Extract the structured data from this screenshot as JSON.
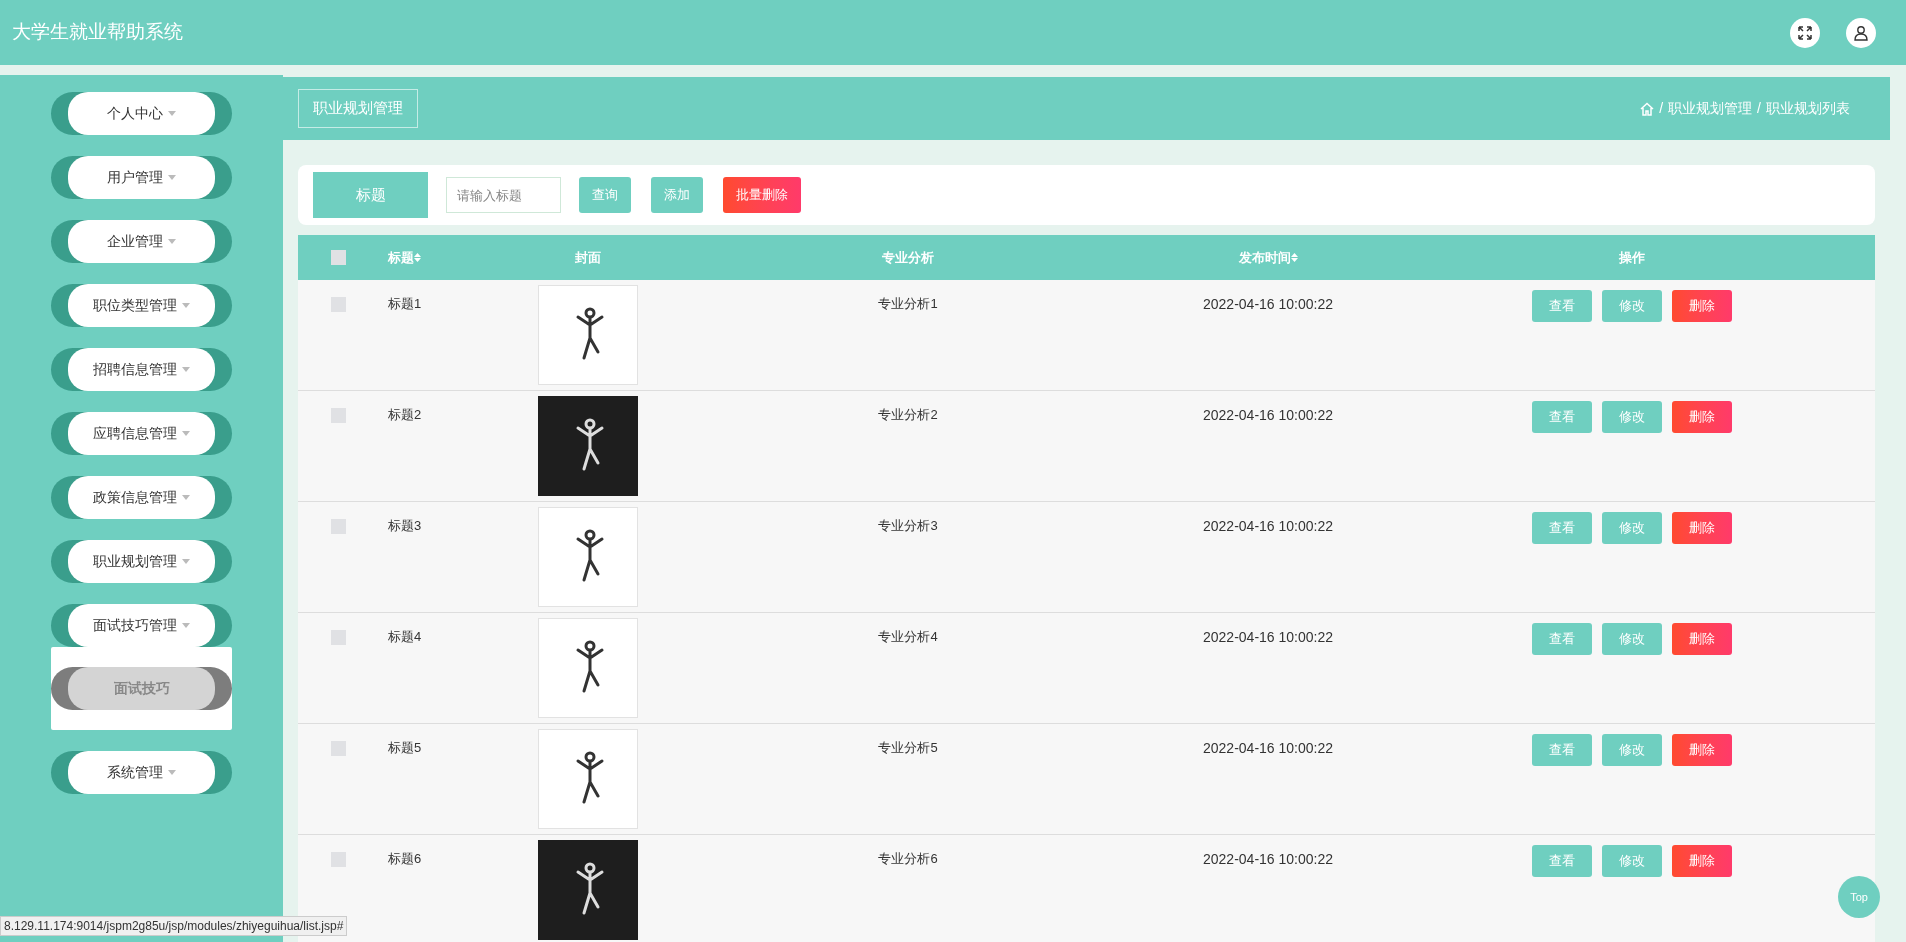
{
  "header": {
    "title": "大学生就业帮助系统"
  },
  "sidebar": {
    "items": [
      {
        "label": "个人中心"
      },
      {
        "label": "用户管理"
      },
      {
        "label": "企业管理"
      },
      {
        "label": "职位类型管理"
      },
      {
        "label": "招聘信息管理"
      },
      {
        "label": "应聘信息管理"
      },
      {
        "label": "政策信息管理"
      },
      {
        "label": "职业规划管理"
      },
      {
        "label": "面试技巧管理",
        "children": [
          {
            "label": "面试技巧"
          }
        ]
      },
      {
        "label": "系统管理"
      }
    ]
  },
  "page": {
    "title": "职业规划管理",
    "breadcrumb": [
      {
        "separator": "/",
        "label": "职业规划管理"
      },
      {
        "separator": "/",
        "label": "职业规划列表"
      }
    ]
  },
  "search": {
    "label": "标题",
    "placeholder": "请输入标题",
    "buttons": [
      {
        "label": "查询",
        "kind": "primary"
      },
      {
        "label": "添加",
        "kind": "primary"
      },
      {
        "label": "批量删除",
        "kind": "danger"
      }
    ]
  },
  "table": {
    "columns": [
      {
        "label": "标题",
        "sortable": true
      },
      {
        "label": "封面",
        "sortable": false
      },
      {
        "label": "专业分析",
        "sortable": false
      },
      {
        "label": "发布时间",
        "sortable": true
      },
      {
        "label": "操作",
        "sortable": false
      }
    ],
    "header_checked": false,
    "rows": [
      {
        "checked": false,
        "title": "标题1",
        "cover": {
          "kind": "light"
        },
        "analysis": "专业分析1",
        "time": "2022-04-16 10:00:22",
        "actions": [
          {
            "label": "查看",
            "kind": "primary"
          },
          {
            "label": "修改",
            "kind": "primary"
          },
          {
            "label": "删除",
            "kind": "danger"
          }
        ]
      },
      {
        "checked": false,
        "title": "标题2",
        "cover": {
          "kind": "dark"
        },
        "analysis": "专业分析2",
        "time": "2022-04-16 10:00:22",
        "actions": [
          {
            "label": "查看",
            "kind": "primary"
          },
          {
            "label": "修改",
            "kind": "primary"
          },
          {
            "label": "删除",
            "kind": "danger"
          }
        ]
      },
      {
        "checked": false,
        "title": "标题3",
        "cover": {
          "kind": "light"
        },
        "analysis": "专业分析3",
        "time": "2022-04-16 10:00:22",
        "actions": [
          {
            "label": "查看",
            "kind": "primary"
          },
          {
            "label": "修改",
            "kind": "primary"
          },
          {
            "label": "删除",
            "kind": "danger"
          }
        ]
      },
      {
        "checked": false,
        "title": "标题4",
        "cover": {
          "kind": "light"
        },
        "analysis": "专业分析4",
        "time": "2022-04-16 10:00:22",
        "actions": [
          {
            "label": "查看",
            "kind": "primary"
          },
          {
            "label": "修改",
            "kind": "primary"
          },
          {
            "label": "删除",
            "kind": "danger"
          }
        ]
      },
      {
        "checked": false,
        "title": "标题5",
        "cover": {
          "kind": "light"
        },
        "analysis": "专业分析5",
        "time": "2022-04-16 10:00:22",
        "actions": [
          {
            "label": "查看",
            "kind": "primary"
          },
          {
            "label": "修改",
            "kind": "primary"
          },
          {
            "label": "删除",
            "kind": "danger"
          }
        ]
      },
      {
        "checked": false,
        "title": "标题6",
        "cover": {
          "kind": "dark"
        },
        "analysis": "专业分析6",
        "time": "2022-04-16 10:00:22",
        "actions": [
          {
            "label": "查看",
            "kind": "primary"
          },
          {
            "label": "修改",
            "kind": "primary"
          },
          {
            "label": "删除",
            "kind": "danger"
          }
        ]
      }
    ]
  },
  "top_button": "Top",
  "status_url": "8.129.11.174:9014/jspm2g85u/jsp/modules/zhiyeguihua/list.jsp#"
}
